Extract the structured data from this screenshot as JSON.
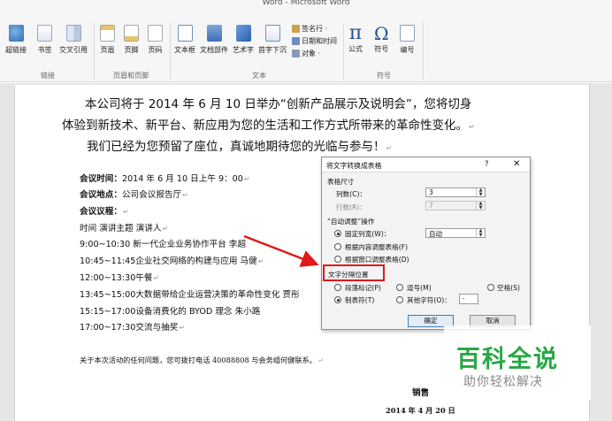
{
  "window": {
    "title": "Word - Microsoft Word"
  },
  "ribbon": {
    "links_group": {
      "label": "链接",
      "buttons": [
        {
          "label": "超链接",
          "icon": "hyperlink-globe-icon"
        },
        {
          "label": "书签",
          "icon": "bookmark-icon"
        },
        {
          "label": "交叉引用",
          "icon": "cross-reference-icon"
        }
      ]
    },
    "header_footer_group": {
      "label": "页眉和页脚",
      "buttons": [
        {
          "label": "页眉",
          "icon": "header-icon"
        },
        {
          "label": "页脚",
          "icon": "footer-icon"
        },
        {
          "label": "页码",
          "icon": "page-number-icon"
        }
      ]
    },
    "text_group": {
      "label": "文本",
      "buttons": [
        {
          "label": "文本框",
          "icon": "text-box-icon"
        },
        {
          "label": "文档部件",
          "icon": "quick-parts-icon"
        },
        {
          "label": "艺术字",
          "icon": "wordart-icon"
        },
        {
          "label": "首字下沉",
          "icon": "drop-cap-icon"
        }
      ],
      "small_buttons": [
        {
          "label": "签名行 ·",
          "icon": "signature-line-icon"
        },
        {
          "label": "日期和时间",
          "icon": "date-time-icon"
        },
        {
          "label": "对象 ·",
          "icon": "object-icon"
        }
      ]
    },
    "symbols_group": {
      "label": "符号",
      "buttons": [
        {
          "label": "公式",
          "icon": "equation-pi-icon",
          "glyph": "π"
        },
        {
          "label": "符号",
          "icon": "symbol-omega-icon",
          "glyph": "Ω"
        },
        {
          "label": "编号",
          "icon": "numbering-icon"
        }
      ]
    }
  },
  "document": {
    "heading_lines": [
      "本公司将于 2014 年 6 月 10 日举办“创新产品展示及说明会”，您将切身",
      "体验到新技术、新平台、新应用为您的生活和工作方式所带来的革命性变化。",
      "我们已经为您预留了座位，真诚地期待您的光临与参与！"
    ],
    "meeting_time_label": "会议时间：",
    "meeting_time_value": "2014 年 6 月 10 日上午 9：00",
    "meeting_place_label": "会议地点：",
    "meeting_place_value": "公司会议报告厅",
    "agenda_label": "会议议程：",
    "agenda_rows": [
      "时间    演讲主题    演讲人",
      "9:00~10:30  新一代企业业务协作平台  李超",
      "10:45~11:45企业社交网络的构建与应用     马健",
      "12:00~13:30午餐",
      "13:45~15:00大数据带给企业运营决策的革命性变化   贾彤",
      "15:15~17:00设备消费化的 BYOD 理念  朱小路",
      "17:00~17:30交流与抽奖"
    ],
    "contact_line": "关于本次活动的任何问题，您可拨打电话 40088808 与会务组何健联系。",
    "signature_partial": "销售",
    "date_partial": "2014 年 4 月 20 日"
  },
  "dialog": {
    "title": "将文字转换成表格",
    "help_label": "?",
    "close_label": "✕",
    "table_size_label": "表格尺寸",
    "columns_label": "列数(C)：",
    "columns_value": "3",
    "rows_label": "行数(R)：",
    "rows_value": "7",
    "autofit_label": "“自动调整”操作",
    "fixed_width_label": "固定列宽(W)：",
    "fixed_width_value": "自动",
    "autofit_content_label": "根据内容调整表格(F)",
    "autofit_window_label": "根据窗口调整表格(D)",
    "separator_label": "文字分隔位置",
    "sep_paragraph": "段落标记(P)",
    "sep_comma": "逗号(M)",
    "sep_space": "空格(S)",
    "sep_tab": "制表符(T)",
    "sep_other": "其他字符(O)：",
    "sep_other_value": "-",
    "ok_label": "确定",
    "cancel_label": "取消",
    "selected_autofit": "fixed",
    "selected_separator": "tab"
  },
  "watermark": {
    "title": "百科全说",
    "subtitle": "助你轻松解决"
  },
  "colors": {
    "annotation_red": "#e0191a",
    "watermark_green": "#28a745",
    "pi_blue": "#1f4e9e"
  }
}
